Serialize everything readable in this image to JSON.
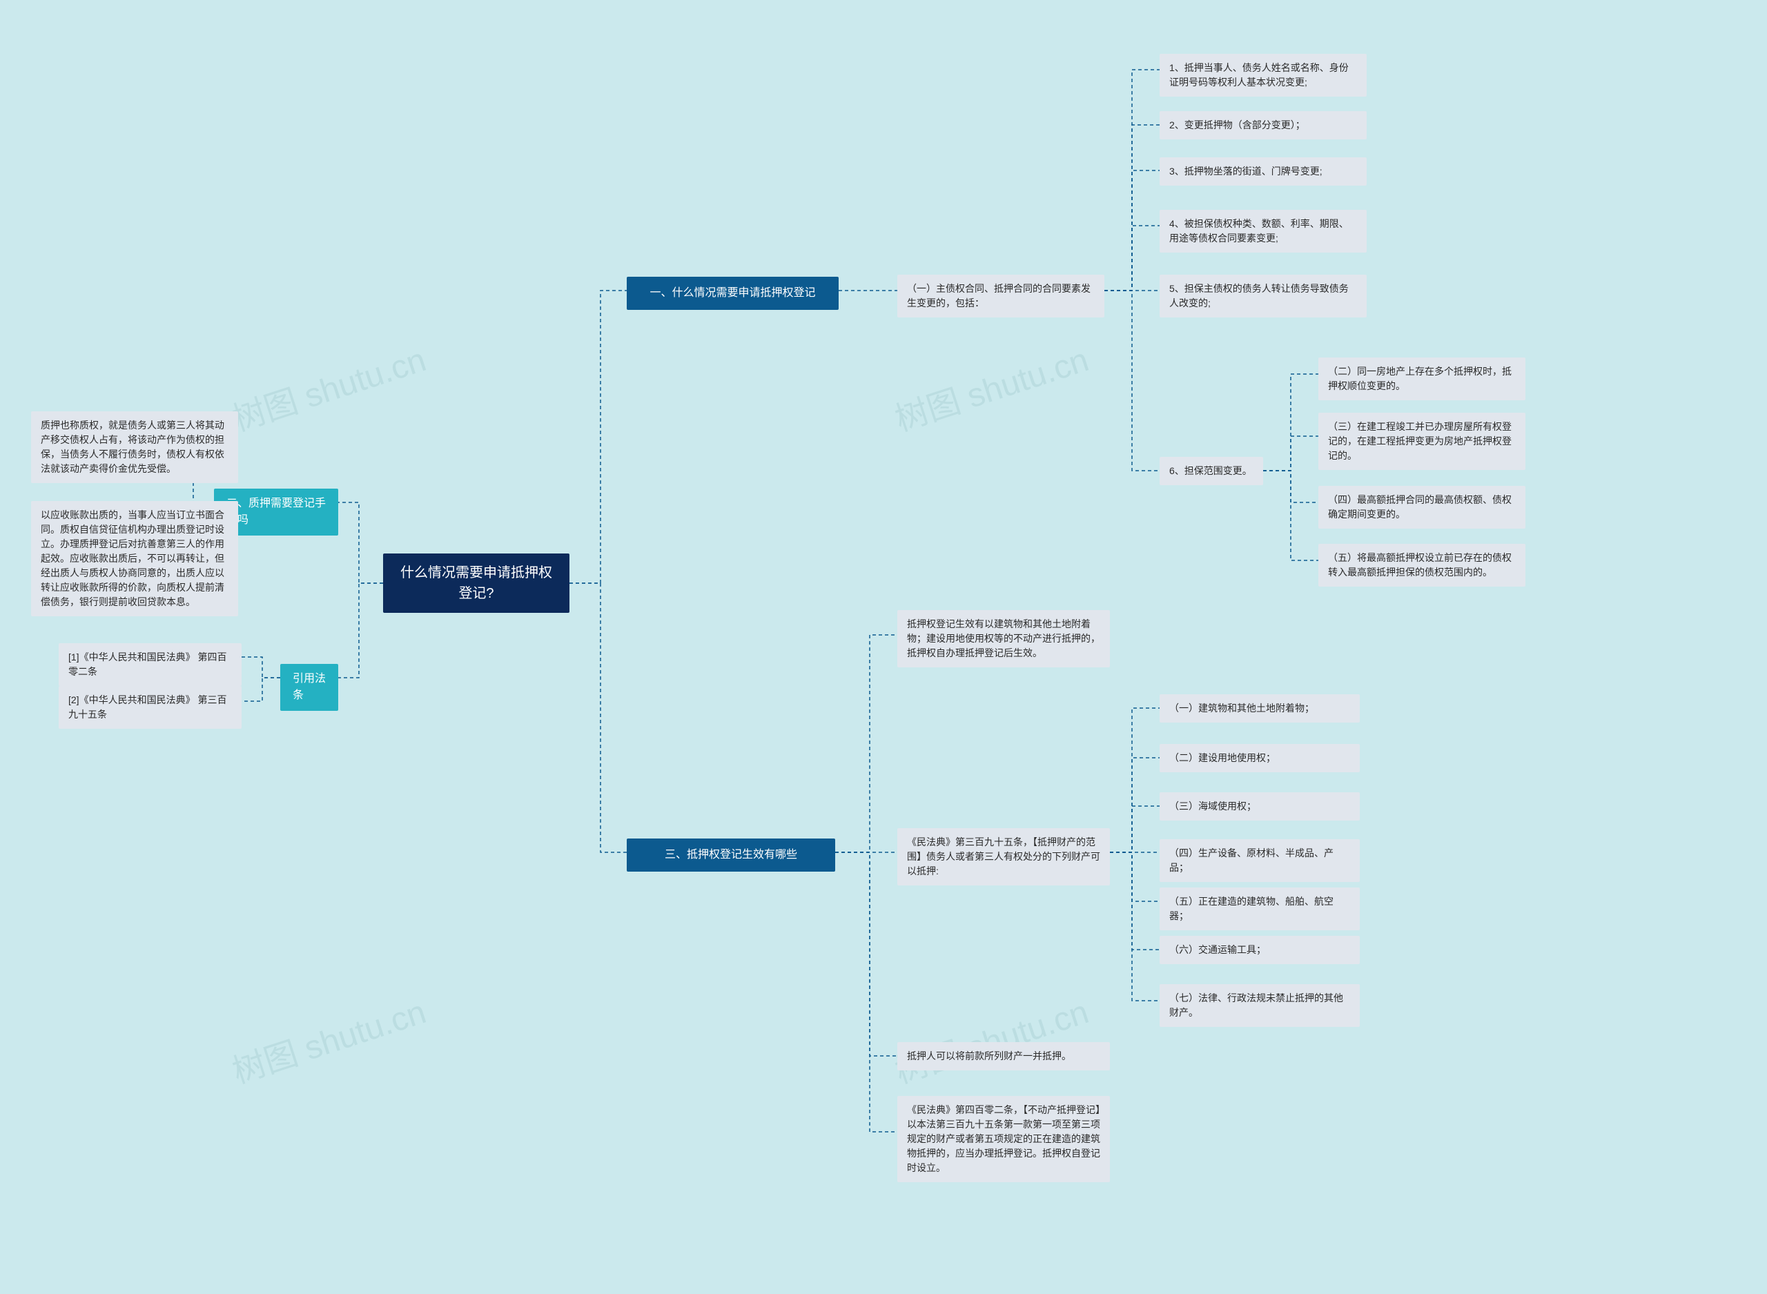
{
  "root": {
    "title": "什么情况需要申请抵押权登记?"
  },
  "branch1": {
    "title": "一、什么情况需要申请抵押权登记"
  },
  "branch1_sub": {
    "title": "（一）主债权合同、抵押合同的合同要素发生变更的，包括："
  },
  "b1_items": [
    "1、抵押当事人、债务人姓名或名称、身份证明号码等权利人基本状况变更;",
    "2、变更抵押物（含部分变更）；",
    "3、抵押物坐落的街道、门牌号变更;",
    "4、被担保债权种类、数额、利率、期限、用途等债权合同要素变更;",
    "5、担保主债权的债务人转让债务导致债务人改变的;",
    "6、担保范围变更。"
  ],
  "b1_6_items": [
    "（二）同一房地产上存在多个抵押权时，抵押权顺位变更的。",
    "（三）在建工程竣工并已办理房屋所有权登记的，在建工程抵押变更为房地产抵押权登记的。",
    "（四）最高额抵押合同的最高债权额、债权确定期间变更的。",
    "（五）将最高额抵押权设立前已存在的债权转入最高额抵押担保的债权范围内的。"
  ],
  "branch2": {
    "title": "二、质押需要登记手续吗"
  },
  "b2_items": [
    "质押也称质权，就是债务人或第三人将其动产移交债权人占有，将该动产作为债权的担保，当债务人不履行债务时，债权人有权依法就该动产卖得价金优先受偿。",
    "以应收账款出质的，当事人应当订立书面合同。质权自信贷征信机构办理出质登记时设立。办理质押登记后对抗善意第三人的作用起效。应收账款出质后，不可以再转让，但经出质人与质权人协商同意的，出质人应以转让应收账款所得的价款，向质权人提前清偿债务，银行则提前收回贷款本息。"
  ],
  "branch3": {
    "title": "三、抵押权登记生效有哪些"
  },
  "b3_items": [
    "抵押权登记生效有以建筑物和其他土地附着物；建设用地使用权等的不动产进行抵押的，抵押权自办理抵押登记后生效。",
    "《民法典》第三百九十五条，【抵押财产的范围】债务人或者第三人有权处分的下列财产可以抵押:",
    "抵押人可以将前款所列财产一并抵押。",
    "《民法典》第四百零二条，【不动产抵押登记】以本法第三百九十五条第一款第一项至第三项规定的财产或者第五项规定的正在建造的建筑物抵押的，应当办理抵押登记。抵押权自登记时设立。"
  ],
  "b3_list": [
    "（一）建筑物和其他土地附着物；",
    "（二）建设用地使用权；",
    "（三）海域使用权；",
    "（四）生产设备、原材料、半成品、产品；",
    "（五）正在建造的建筑物、船舶、航空器；",
    "（六）交通运输工具；",
    "（七）法律、行政法规未禁止抵押的其他财产。"
  ],
  "branch_ref": {
    "title": "引用法条"
  },
  "ref_items": [
    "[1]《中华人民共和国民法典》 第四百零二条",
    "[2]《中华人民共和国民法典》 第三百九十五条"
  ],
  "watermark": "树图 shutu.cn"
}
